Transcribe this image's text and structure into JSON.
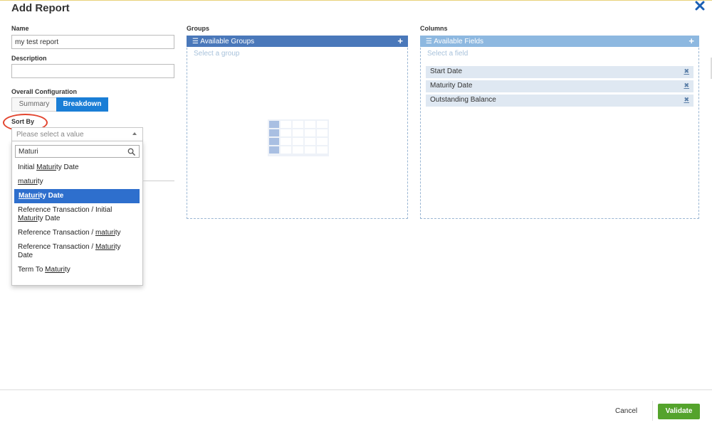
{
  "dialog": {
    "title": "Add Report"
  },
  "left": {
    "name_label": "Name",
    "name_value": "my test report",
    "description_label": "Description",
    "description_value": "",
    "overall_label": "Overall Configuration",
    "segment": {
      "summary": "Summary",
      "breakdown": "Breakdown",
      "selected": "Breakdown"
    },
    "sort_label": "Sort By",
    "sort_placeholder": "Please select a value",
    "search_value": "Maturi",
    "options": [
      {
        "pre": "Initial ",
        "match": "Maturi",
        "post": "ty Date",
        "selected": false
      },
      {
        "pre": "",
        "match": "maturi",
        "post": "ty",
        "selected": false
      },
      {
        "pre": "",
        "match": "Maturi",
        "post": "ty Date",
        "selected": true
      },
      {
        "pre": "Reference Transaction / Initial ",
        "match": "Maturi",
        "post": "ty Date",
        "selected": false
      },
      {
        "pre": "Reference Transaction / ",
        "match": "maturi",
        "post": "ty",
        "selected": false
      },
      {
        "pre": "Reference Transaction / ",
        "match": "Maturi",
        "post": "ty Date",
        "selected": false
      },
      {
        "pre": "Term To ",
        "match": "Maturi",
        "post": "ty",
        "selected": false
      }
    ]
  },
  "groups": {
    "label": "Groups",
    "header": "Available Groups",
    "placeholder": "Select a group"
  },
  "columns": {
    "label": "Columns",
    "header": "Available Fields",
    "placeholder": "Select a field",
    "fields": [
      "Start Date",
      "Maturity Date",
      "Outstanding Balance"
    ],
    "remove_glyph": "✖"
  },
  "footer": {
    "cancel": "Cancel",
    "validate": "Validate"
  },
  "colors": {
    "primary": "#1a7ed6",
    "groups_header": "#4a78ba",
    "fields_header": "#8db8e0",
    "validate": "#54a32c",
    "highlight": "#e34630"
  }
}
